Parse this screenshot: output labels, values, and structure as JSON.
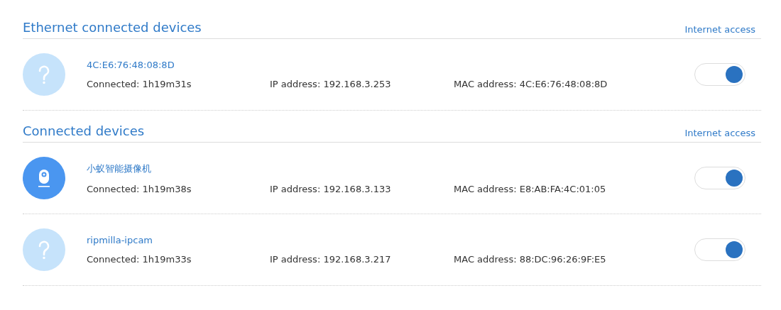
{
  "sections": [
    {
      "title": "Ethernet connected devices",
      "column_label": "Internet access",
      "devices": [
        {
          "kind": "unknown",
          "name": "4C:E6:76:48:08:8D",
          "connected": "Connected: 1h19m31s",
          "ip": "IP address: 192.168.3.253",
          "mac": "MAC address: 4C:E6:76:48:08:8D",
          "on": true
        }
      ]
    },
    {
      "title": "Connected devices",
      "column_label": "Internet access",
      "devices": [
        {
          "kind": "camera",
          "name": "小蚁智能摄像机",
          "connected": "Connected: 1h19m38s",
          "ip": "IP address: 192.168.3.133",
          "mac": "MAC address: E8:AB:FA:4C:01:05",
          "on": true
        },
        {
          "kind": "unknown",
          "name": "ripmilla-ipcam",
          "connected": "Connected: 1h19m33s",
          "ip": "IP address: 192.168.3.217",
          "mac": "MAC address: 88:DC:96:26:9F:E5",
          "on": true
        }
      ]
    }
  ]
}
